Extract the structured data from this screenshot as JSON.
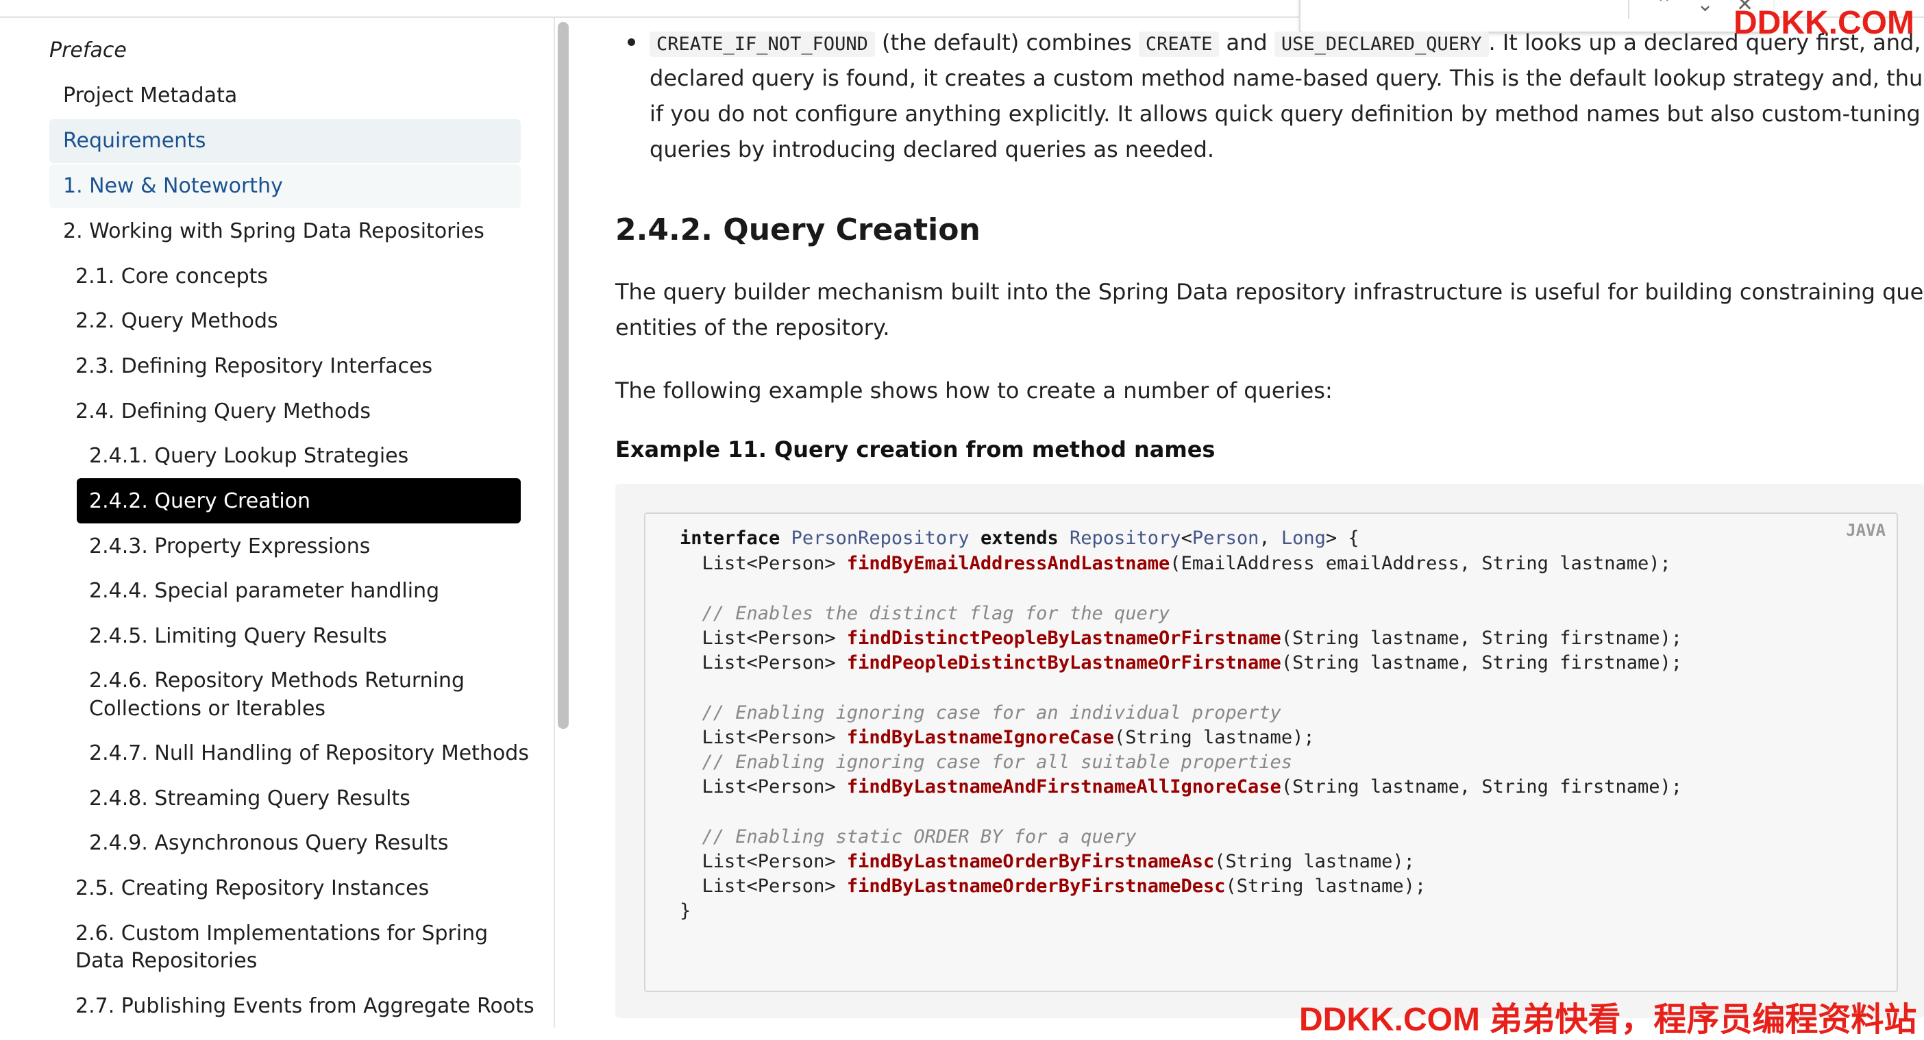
{
  "watermark": {
    "top": "DDKK.COM",
    "bottom": "DDKK.COM 弟弟快看，程序员编程资料站"
  },
  "find_bar": {
    "prev": "⌃",
    "next": "⌄",
    "close": "✕"
  },
  "sidebar": {
    "items": [
      {
        "label": "Preface"
      },
      {
        "label": "Project Metadata"
      },
      {
        "label": "Requirements"
      },
      {
        "label": "1. New & Noteworthy"
      },
      {
        "label": "2. Working with Spring Data Repositories"
      },
      {
        "label": "2.1. Core concepts"
      },
      {
        "label": "2.2. Query Methods"
      },
      {
        "label": "2.3. Defining Repository Interfaces"
      },
      {
        "label": "2.4. Defining Query Methods"
      },
      {
        "label": "2.4.1. Query Lookup Strategies"
      },
      {
        "label": "2.4.2. Query Creation"
      },
      {
        "label": "2.4.3. Property Expressions"
      },
      {
        "label": "2.4.4. Special parameter handling"
      },
      {
        "label": "2.4.5. Limiting Query Results"
      },
      {
        "label": "2.4.6. Repository Methods Returning",
        "label2": "Collections or Iterables"
      },
      {
        "label": "2.4.7. Null Handling of Repository Methods"
      },
      {
        "label": "2.4.8. Streaming Query Results"
      },
      {
        "label": "2.4.9. Asynchronous Query Results"
      },
      {
        "label": "2.5. Creating Repository Instances"
      },
      {
        "label": "2.6. Custom Implementations for Spring",
        "label2": "Data Repositories"
      },
      {
        "label": "2.7. Publishing Events from Aggregate Roots"
      }
    ]
  },
  "content": {
    "bullet": {
      "code1": "CREATE_IF_NOT_FOUND",
      "t1": " (the default) combines ",
      "code2": "CREATE",
      "t2": " and ",
      "code3": "USE_DECLARED_QUERY",
      "t3": ". It looks up a declared query first, and, if no",
      "line2": "declared query is found, it creates a custom method name-based query. This is the default lookup strategy and, thus, is used",
      "line3": "if you do not configure anything explicitly. It allows quick query definition by method names but also custom-tuning of these",
      "line4": "queries by introducing declared queries as needed."
    },
    "heading": "2.4.2. Query Creation",
    "para1_line1": "The query builder mechanism built into the Spring Data repository infrastructure is useful for building constraining queries over",
    "para1_line2": "entities of the repository.",
    "para2": "The following example shows how to create a number of queries:",
    "example_title": "Example 11. Query creation from method names",
    "code_lang": "JAVA",
    "code": {
      "l1": {
        "kw1": "interface",
        "ty1": "PersonRepository",
        "kw2": "extends",
        "ty2": "Repository",
        "lt": "<",
        "ty3": "Person",
        "sep": ", ",
        "ty4": "Long",
        "gt": "> {"
      },
      "l2": {
        "pre": "  List<Person> ",
        "fn": "findByEmailAddressAndLastname",
        "post": "(EmailAddress emailAddress, String lastname);"
      },
      "c1": "  // Enables the distinct flag for the query",
      "l3": {
        "pre": "  List<Person> ",
        "fn": "findDistinctPeopleByLastnameOrFirstname",
        "post": "(String lastname, String firstname);"
      },
      "l4": {
        "pre": "  List<Person> ",
        "fn": "findPeopleDistinctByLastnameOrFirstname",
        "post": "(String lastname, String firstname);"
      },
      "c2": "  // Enabling ignoring case for an individual property",
      "l5": {
        "pre": "  List<Person> ",
        "fn": "findByLastnameIgnoreCase",
        "post": "(String lastname);"
      },
      "c3": "  // Enabling ignoring case for all suitable properties",
      "l6": {
        "pre": "  List<Person> ",
        "fn": "findByLastnameAndFirstnameAllIgnoreCase",
        "post": "(String lastname, String firstname);"
      },
      "c4": "  // Enabling static ORDER BY for a query",
      "l7": {
        "pre": "  List<Person> ",
        "fn": "findByLastnameOrderByFirstnameAsc",
        "post": "(String lastname);"
      },
      "l8": {
        "pre": "  List<Person> ",
        "fn": "findByLastnameOrderByFirstnameDesc",
        "post": "(String lastname);"
      },
      "close": "}"
    }
  }
}
